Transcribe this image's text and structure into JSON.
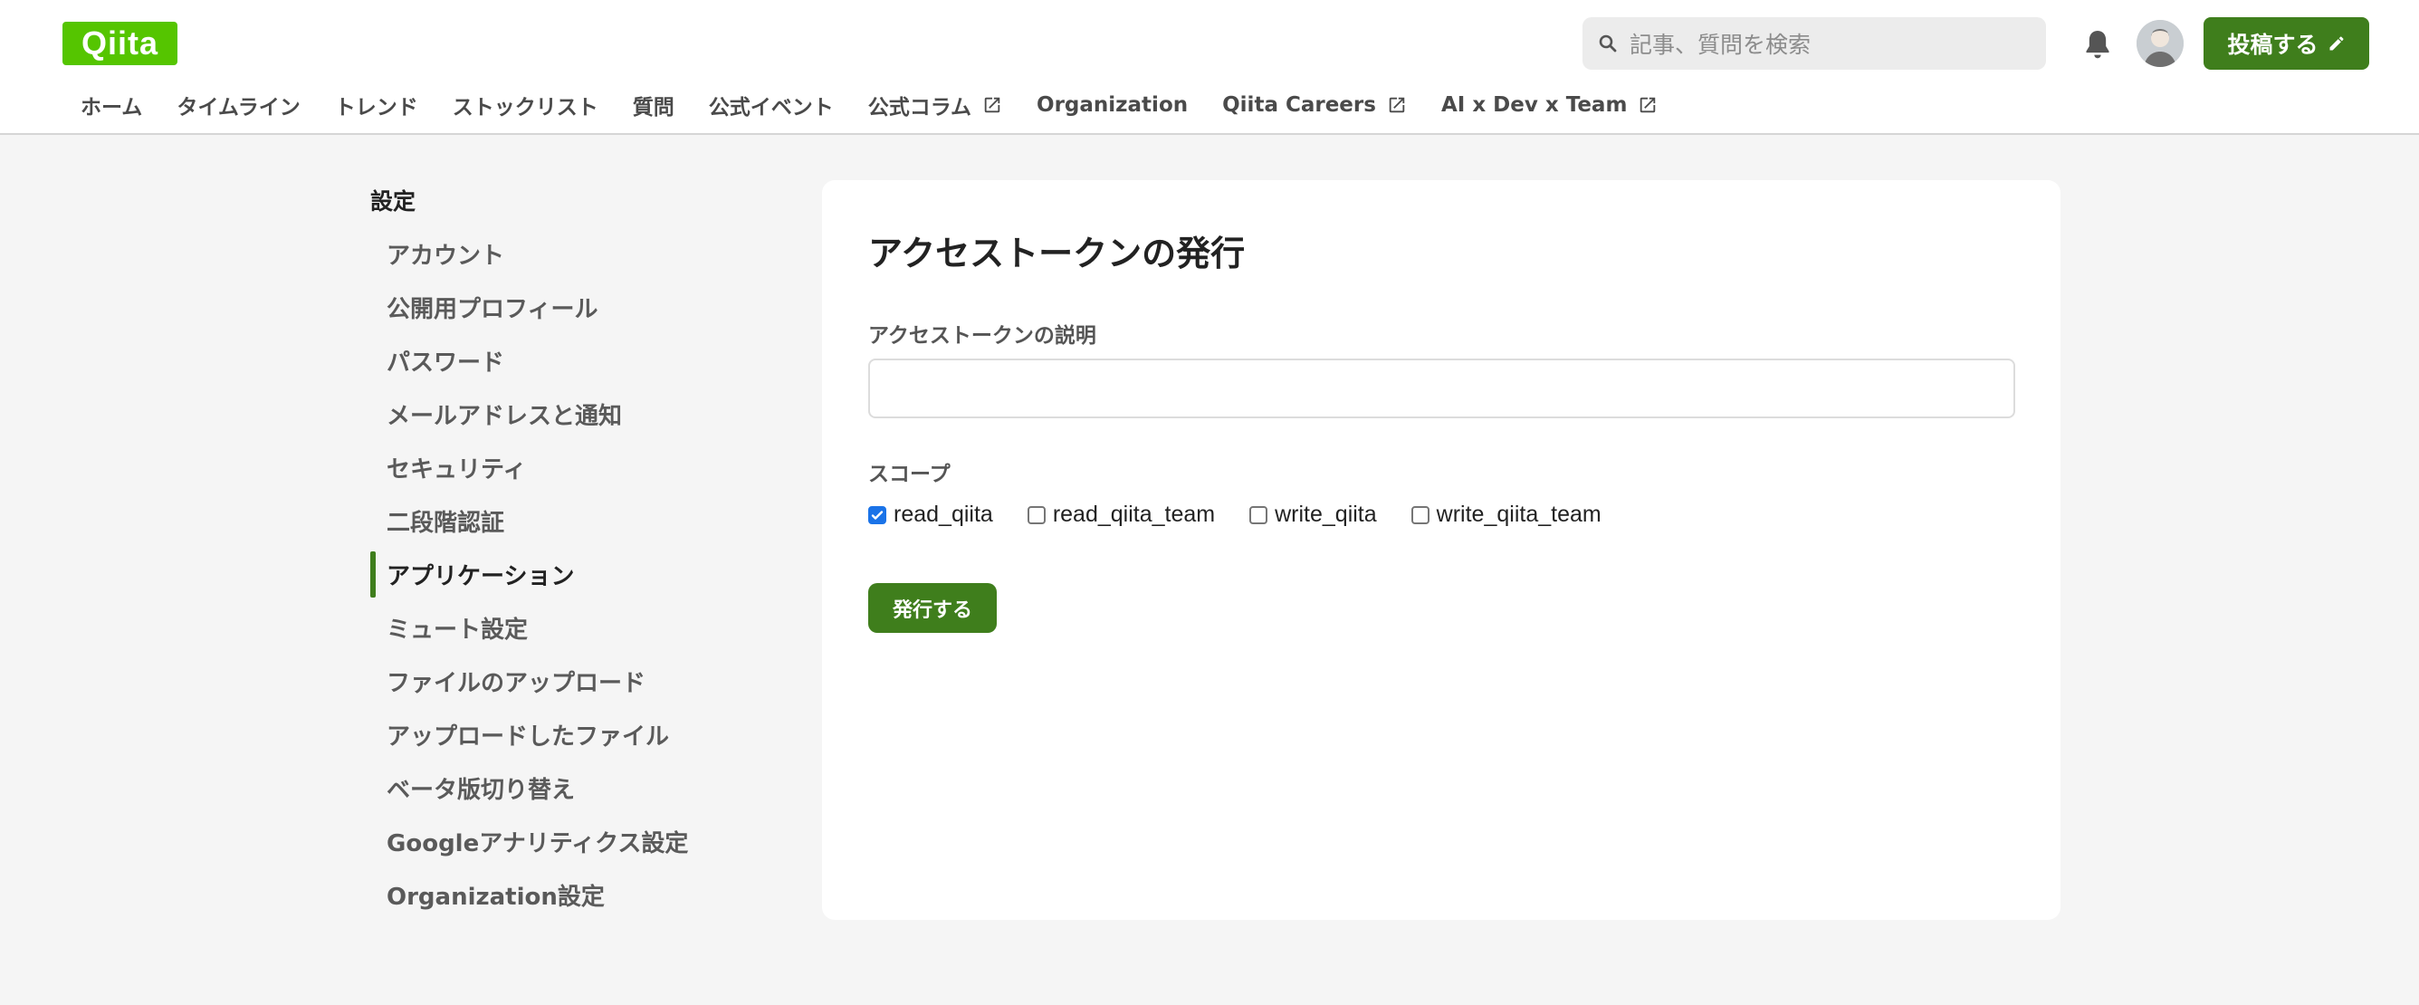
{
  "brand": {
    "logo_text": "Qiita",
    "accent_color": "#55c500",
    "primary_green": "#3f7e1c"
  },
  "header": {
    "search": {
      "placeholder": "記事、質問を検索",
      "icon": "search-icon"
    },
    "notification_icon": "bell-icon",
    "post_button": {
      "label": "投稿する",
      "icon": "pencil-icon"
    }
  },
  "nav": {
    "items": [
      {
        "label": "ホーム",
        "external": false
      },
      {
        "label": "タイムライン",
        "external": false
      },
      {
        "label": "トレンド",
        "external": false
      },
      {
        "label": "ストックリスト",
        "external": false
      },
      {
        "label": "質問",
        "external": false
      },
      {
        "label": "公式イベント",
        "external": false
      },
      {
        "label": "公式コラム",
        "external": true
      },
      {
        "label": "Organization",
        "external": false
      },
      {
        "label": "Qiita Careers",
        "external": true
      },
      {
        "label": "AI x Dev x Team",
        "external": true
      }
    ]
  },
  "sidebar": {
    "title": "設定",
    "items": [
      {
        "label": "アカウント",
        "active": false
      },
      {
        "label": "公開用プロフィール",
        "active": false
      },
      {
        "label": "パスワード",
        "active": false
      },
      {
        "label": "メールアドレスと通知",
        "active": false
      },
      {
        "label": "セキュリティ",
        "active": false
      },
      {
        "label": "二段階認証",
        "active": false
      },
      {
        "label": "アプリケーション",
        "active": true
      },
      {
        "label": "ミュート設定",
        "active": false
      },
      {
        "label": "ファイルのアップロード",
        "active": false
      },
      {
        "label": "アップロードしたファイル",
        "active": false
      },
      {
        "label": "ベータ版切り替え",
        "active": false
      },
      {
        "label": "Googleアナリティクス設定",
        "active": false
      },
      {
        "label": "Organization設定",
        "active": false
      }
    ]
  },
  "main": {
    "title": "アクセストークンの発行",
    "description_label": "アクセストークンの説明",
    "description_value": "",
    "scope_label": "スコープ",
    "scopes": [
      {
        "label": "read_qiita",
        "checked": true
      },
      {
        "label": "read_qiita_team",
        "checked": false
      },
      {
        "label": "write_qiita",
        "checked": false
      },
      {
        "label": "write_qiita_team",
        "checked": false
      }
    ],
    "submit_label": "発行する"
  }
}
